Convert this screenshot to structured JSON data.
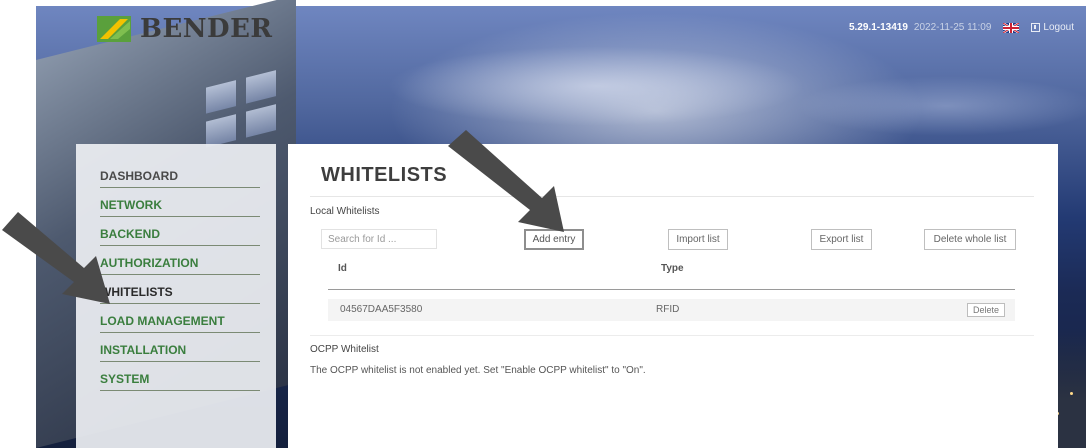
{
  "brand": {
    "name": "BENDER"
  },
  "header": {
    "version": "5.29.1-13419",
    "datetime": "2022-11-25 11:09",
    "language_icon": "uk-flag-icon",
    "logout_label": "Logout"
  },
  "sidebar": {
    "items": [
      {
        "label": "DASHBOARD",
        "state": "normal"
      },
      {
        "label": "NETWORK",
        "state": "normal"
      },
      {
        "label": "BACKEND",
        "state": "normal"
      },
      {
        "label": "AUTHORIZATION",
        "state": "normal"
      },
      {
        "label": "WHITELISTS",
        "state": "active"
      },
      {
        "label": "LOAD MANAGEMENT",
        "state": "normal"
      },
      {
        "label": "INSTALLATION",
        "state": "normal"
      },
      {
        "label": "SYSTEM",
        "state": "normal"
      }
    ]
  },
  "main": {
    "title": "WHITELISTS",
    "local_section_label": "Local Whitelists",
    "search": {
      "placeholder": "Search for Id ..."
    },
    "buttons": {
      "add": "Add entry",
      "import": "Import list",
      "export": "Export list",
      "delete_all": "Delete whole list"
    },
    "table": {
      "columns": [
        "Id",
        "Type"
      ],
      "rows": [
        {
          "id": "04567DAA5F3580",
          "type": "RFID",
          "action": "Delete"
        }
      ]
    },
    "ocpp_section_label": "OCPP Whitelist",
    "ocpp_message": "The OCPP whitelist is not enabled yet. Set \"Enable OCPP whitelist\" to \"On\"."
  },
  "colors": {
    "nav_green": "#3a7e3e",
    "logo_green": "#5aa03c",
    "logo_yellow": "#f2c200",
    "annotation_arrow": "#4a4a4a"
  }
}
